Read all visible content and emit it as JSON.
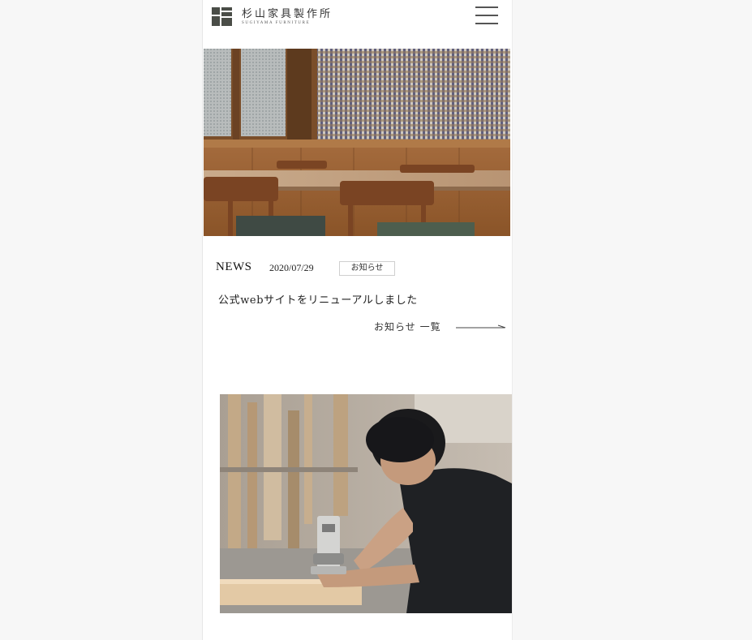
{
  "brand": {
    "name_jp": "杉山家具製作所",
    "name_en": "SUGIYAMA FURNITURE"
  },
  "header": {
    "menu_icon": "hamburger-menu-icon"
  },
  "hero": {
    "description": "dining-room-photo"
  },
  "news": {
    "heading": "NEWS",
    "items": [
      {
        "date": "2020/07/29",
        "category": "お知らせ",
        "title": "公式webサイトをリニューアルしました"
      }
    ],
    "list_link_label": "お知らせ 一覧",
    "list_link_icon": "long-arrow-right-icon"
  },
  "feature": {
    "image": "craftsman-routing-wood-photo"
  },
  "colors": {
    "logo": "#4a4d47",
    "text": "#222222",
    "page_bg": "#f7f7f7"
  }
}
